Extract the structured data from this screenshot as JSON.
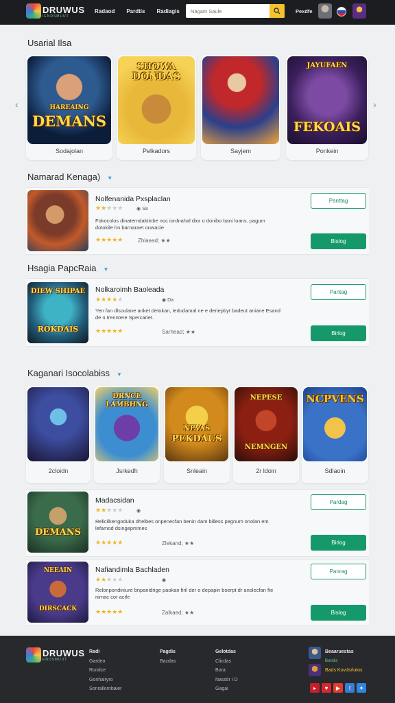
{
  "header": {
    "logo": "DRUWUS",
    "logo_sub": "IENDSMUUT",
    "nav": [
      "Radaod",
      "Pardtis",
      "Radiagis"
    ],
    "search_placeholder": "Nagam Saule",
    "right_label": "Pexdfe"
  },
  "sections": {
    "featured": "Usarial Ilsa",
    "popular": "Namarad Kenaga)",
    "trending": "Hsagia PapcRaia",
    "recommended": "Kaganari Isocolabiss"
  },
  "featured_cards": [
    {
      "label": "Sodajolan",
      "art": "DEMANS",
      "art_top": "HAREAING"
    },
    {
      "label": "Pelkadors",
      "art": "DONDAS",
      "art_top": "SHOWA"
    },
    {
      "label": "Sayjem",
      "art": "",
      "art_top": ""
    },
    {
      "label": "Ponkein",
      "art": "FEKOAIS",
      "art_top": "JAYUFAEN"
    }
  ],
  "list_a": [
    {
      "title": "Nolfenanida Pxsplaclan",
      "rating": 2,
      "meta": "Sa",
      "desc": "Fokocolos dinaterndaktinbe noc iordnahal dior o donibo bani loans. pagum dotokile hn barnaraet ouwacie",
      "small": "Zhlaead;",
      "art": "",
      "btn_outline": "Panttag",
      "btn_solid": "Bislog"
    }
  ],
  "list_b": [
    {
      "title": "Nolkaroimh Baoleada",
      "rating": 4,
      "meta": "Da",
      "desc": "Yen fan dlsoulane anket detokan, ledudamal ne e deriepbyt badeut aniane Esand de n Irenntere Spercariet.",
      "small": "Sarhead;",
      "art": "ROKDAIS",
      "art_top": "DIEW SHIPAE",
      "btn_outline": "Pantag",
      "btn_solid": "Birlog"
    }
  ],
  "rec_cards": [
    {
      "label": "2cloidn",
      "art": ""
    },
    {
      "label": "Jsrkedh",
      "art": "LAMBHNG",
      "art_top": "DRNCE"
    },
    {
      "label": "Snleain",
      "art": "PEKDAUS",
      "art_top": "NEVAS"
    },
    {
      "label": "2r ldoin",
      "art": "NEMNGEN",
      "art_top": "NEPESE"
    },
    {
      "label": "Sdlaoin",
      "art": "NCPVENS",
      "art_top": ""
    }
  ],
  "list_c": [
    {
      "title": "Madacsidan",
      "rating": 2,
      "meta": "",
      "desc": "Relicilkengoduka dhelbes onpenecfan benin dam billess pegnum onolan em lefamod dsingepmmes",
      "small": "Zlekand;",
      "art": "DEMANS",
      "btn_outline": "Pardag",
      "btn_solid": "Birlog"
    },
    {
      "title": "Nafiandimla Bachladen",
      "rating": 2,
      "meta": "",
      "desc": "Relonpondiniure bnpanidrige paokan firil der o depapin boerpt dr anolecfan fte nimac cor acife",
      "small": "Zalkaed;",
      "art": "DIRSCACK",
      "art_top": "NEEAIN",
      "btn_outline": "Panrag",
      "btn_solid": "Bislog"
    }
  ],
  "footer": {
    "logo": "DRUWUS",
    "logo_sub": "ENDSMUUT",
    "col1": [
      "Radi",
      "Gardeo",
      "Roralce",
      "Gonhairyro",
      "Sonrallornbaier"
    ],
    "col2": [
      "Pagdis",
      "Bacdas"
    ],
    "col3": [
      "Gelotdas",
      "Clicdas",
      "Bora",
      "Nasstir I D",
      "Gagai"
    ],
    "profile_name": "Beaaruestas",
    "profile_sub": "Boridis",
    "profile2": "Bads Kovdsrlutos"
  },
  "colors": {
    "accent": "#16996a",
    "star": "#f2b31c",
    "header_bg": "#1b1d21",
    "search_btn": "#f4c22b"
  },
  "icons": [
    "search-icon",
    "chevron-left-icon",
    "chevron-right-icon",
    "chevron-down-icon",
    "flag-icon"
  ]
}
